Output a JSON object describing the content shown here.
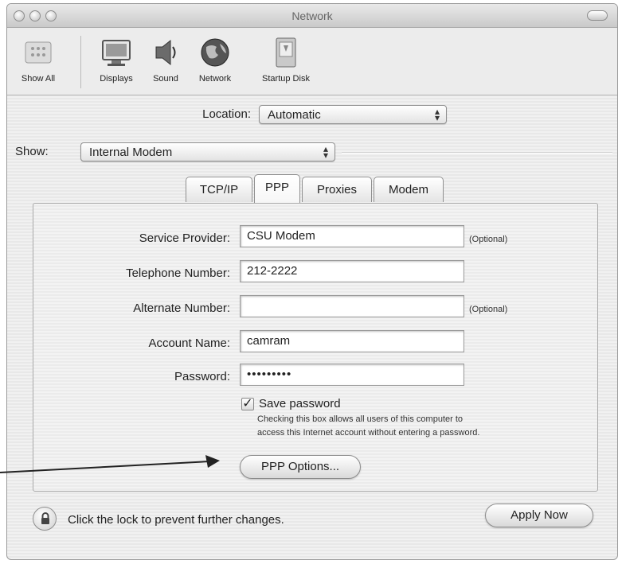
{
  "window": {
    "title": "Network"
  },
  "toolbar": {
    "items": [
      {
        "label": "Show All",
        "icon": "apple-logo-icon"
      },
      {
        "label": "Displays",
        "icon": "display-icon"
      },
      {
        "label": "Sound",
        "icon": "speaker-icon"
      },
      {
        "label": "Network",
        "icon": "globe-icon"
      },
      {
        "label": "Startup Disk",
        "icon": "hard-disk-icon"
      }
    ]
  },
  "location": {
    "label": "Location:",
    "value": "Automatic"
  },
  "show": {
    "label": "Show:",
    "value": "Internal Modem"
  },
  "tabs": [
    {
      "label": "TCP/IP",
      "active": false
    },
    {
      "label": "PPP",
      "active": true
    },
    {
      "label": "Proxies",
      "active": false
    },
    {
      "label": "Modem",
      "active": false
    }
  ],
  "form": {
    "service_provider": {
      "label": "Service Provider:",
      "value": "CSU Modem",
      "note": "(Optional)"
    },
    "telephone_number": {
      "label": "Telephone Number:",
      "value": "212-2222"
    },
    "alternate_number": {
      "label": "Alternate Number:",
      "value": "",
      "note": "(Optional)"
    },
    "account_name": {
      "label": "Account Name:",
      "value": "camram"
    },
    "password": {
      "label": "Password:",
      "value": "•••••••••"
    },
    "save_password": {
      "label": "Save password",
      "checked": true,
      "help_line1": "Checking this box allows all users of this computer to",
      "help_line2": "access this Internet account without entering a password."
    },
    "ppp_options_button": "PPP Options..."
  },
  "footer": {
    "lock_text": "Click the lock to prevent further changes.",
    "apply_button": "Apply Now"
  }
}
